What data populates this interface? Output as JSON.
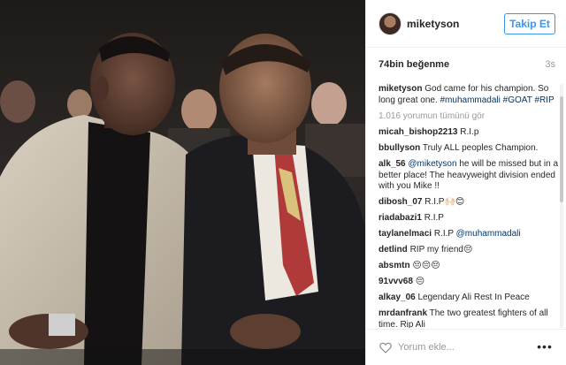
{
  "post": {
    "username": "miketyson",
    "follow_label": "Takip Et",
    "likes": "74bin beğenme",
    "time": "3s"
  },
  "caption": {
    "user": "miketyson",
    "text": "God came for his champion. So long great one.",
    "tags": "#muhammadali #GOAT #RIP"
  },
  "view_all": "1.016 yorumun tümünü gör",
  "comments": [
    {
      "user": "micah_bishop2213",
      "text": "R.I.p",
      "mention": ""
    },
    {
      "user": "bbullyson",
      "text": "Truly ALL peoples Champion.",
      "mention": ""
    },
    {
      "user": "alk_56",
      "mention": "@miketyson",
      "text": "he will be missed but in a better place! The heavyweight division ended with you Mike !!"
    },
    {
      "user": "dibosh_07",
      "text": "R.I.P🙌🏻😊",
      "mention": ""
    },
    {
      "user": "riadabazi1",
      "text": "R.I.P",
      "mention": ""
    },
    {
      "user": "taylanelmaci",
      "text": "R.I.P",
      "mention": "@muhammadali"
    },
    {
      "user": "detlind",
      "text": "RIP my friend😔",
      "mention": ""
    },
    {
      "user": "absmtn",
      "text": "😔😔😔",
      "mention": ""
    },
    {
      "user": "91vvv68",
      "text": "😔",
      "mention": ""
    },
    {
      "user": "alkay_06",
      "text": "Legendary Ali Rest In Peace",
      "mention": ""
    },
    {
      "user": "mrdanfrank",
      "text": "The two greatest fighters of all time. Rip Ali",
      "mention": ""
    }
  ],
  "input": {
    "placeholder": "Yorum ekle..."
  },
  "icons": {
    "like": "heart-icon",
    "more": "more-options-icon"
  },
  "colors": {
    "accent": "#3897f0",
    "link": "#003569",
    "muted": "#999999"
  }
}
